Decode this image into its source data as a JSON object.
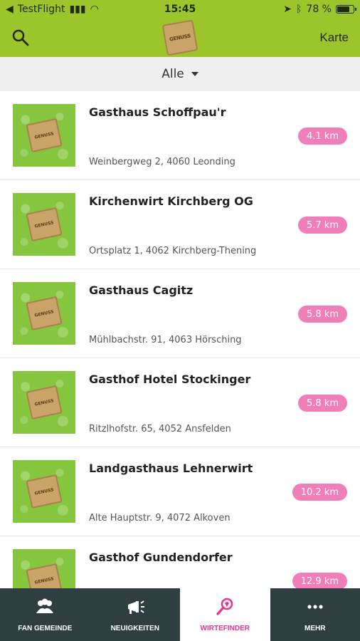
{
  "status_bar": {
    "carrier": "TestFlight",
    "time": "15:45",
    "battery_text": "78 %",
    "battery_level": 0.78
  },
  "nav": {
    "search_icon": "search-icon",
    "logo_text": "GENUSS",
    "right_link": "Karte"
  },
  "filter": {
    "selected": "Alle"
  },
  "restaurants": [
    {
      "name": "Gasthaus Schoffpau'r",
      "address": "Weinbergweg 2, 4060 Leonding",
      "distance": "4.1 km"
    },
    {
      "name": "Kirchenwirt Kirchberg OG",
      "address": "Ortsplatz 1, 4062 Kirchberg-Thening",
      "distance": "5.7 km"
    },
    {
      "name": "Gasthaus Cagitz",
      "address": "Mühlbachstr. 91, 4063 Hörsching",
      "distance": "5.8 km"
    },
    {
      "name": "Gasthof Hotel Stockinger",
      "address": "Ritzlhofstr. 65, 4052 Ansfelden",
      "distance": "5.8 km"
    },
    {
      "name": "Landgasthaus Lehnerwirt",
      "address": "Alte Hauptstr. 9, 4072 Alkoven",
      "distance": "10.2 km"
    },
    {
      "name": "Gasthof Gundendorfer",
      "address": "",
      "distance": "12.9 km"
    }
  ],
  "tabs": [
    {
      "label": "FAN GEMEINDE",
      "icon": "group-icon"
    },
    {
      "label": "NEUIGKEITEN",
      "icon": "megaphone-icon"
    },
    {
      "label": "WIRTEFINDER",
      "icon": "magnifier-heart-icon"
    },
    {
      "label": "MEHR",
      "icon": "more-dots-icon"
    }
  ],
  "colors": {
    "header_green": "#9bc52b",
    "distance_pink": "#f07fb9",
    "tab_bar": "#2f3f3f",
    "active_tab": "#e7358d"
  }
}
